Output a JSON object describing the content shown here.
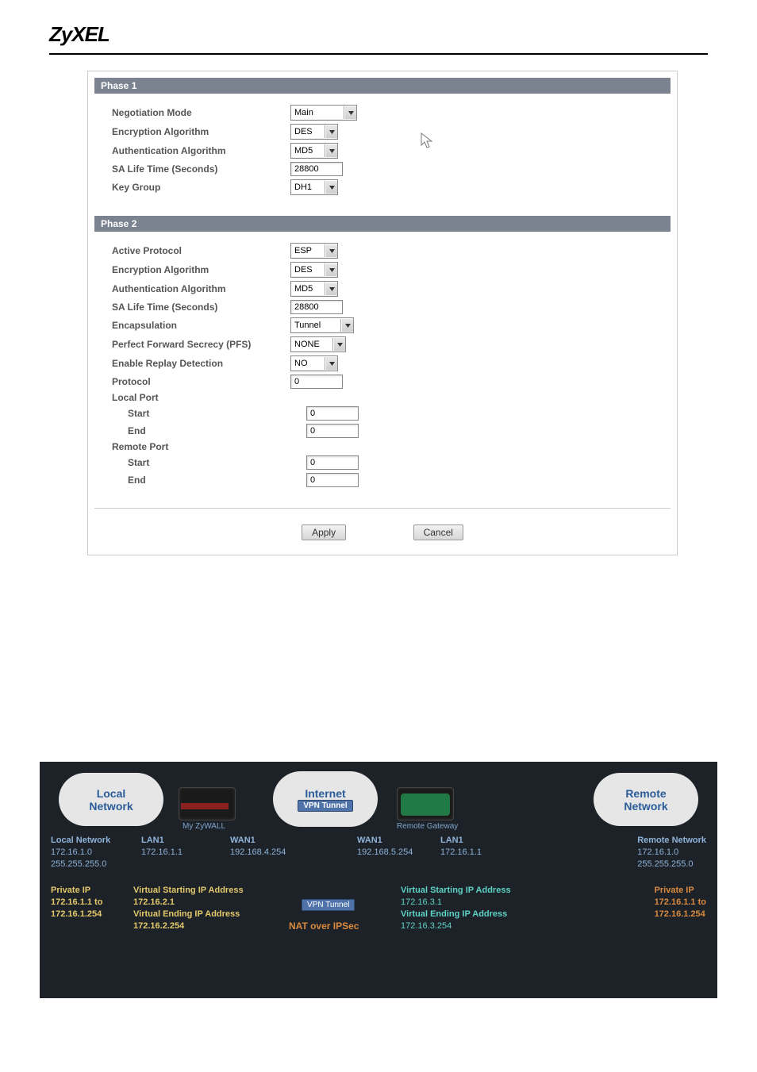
{
  "brand": "ZyXEL",
  "phase1": {
    "title": "Phase 1",
    "fields": {
      "negotiation_mode_label": "Negotiation Mode",
      "negotiation_mode_value": "Main",
      "encryption_label": "Encryption Algorithm",
      "encryption_value": "DES",
      "auth_label": "Authentication Algorithm",
      "auth_value": "MD5",
      "sa_life_label": "SA Life Time (Seconds)",
      "sa_life_value": "28800",
      "key_group_label": "Key Group",
      "key_group_value": "DH1"
    }
  },
  "phase2": {
    "title": "Phase 2",
    "fields": {
      "active_protocol_label": "Active Protocol",
      "active_protocol_value": "ESP",
      "encryption_label": "Encryption Algorithm",
      "encryption_value": "DES",
      "auth_label": "Authentication Algorithm",
      "auth_value": "MD5",
      "sa_life_label": "SA Life Time (Seconds)",
      "sa_life_value": "28800",
      "encapsulation_label": "Encapsulation",
      "encapsulation_value": "Tunnel",
      "pfs_label": "Perfect Forward Secrecy (PFS)",
      "pfs_value": "NONE",
      "replay_label": "Enable Replay Detection",
      "replay_value": "NO",
      "protocol_label": "Protocol",
      "protocol_value": "0",
      "local_port_label": "Local Port",
      "start_label": "Start",
      "local_start_value": "0",
      "end_label": "End",
      "local_end_value": "0",
      "remote_port_label": "Remote Port",
      "remote_start_value": "0",
      "remote_end_value": "0"
    }
  },
  "buttons": {
    "apply": "Apply",
    "cancel": "Cancel"
  },
  "diagram": {
    "local_cloud": "Local\nNetwork",
    "internet_cloud_l1": "Internet",
    "internet_cloud_l2": "VPN Tunnel",
    "remote_cloud": "Remote\nNetwork",
    "my_zywall": "My ZyWALL",
    "remote_gateway": "Remote Gateway",
    "local_network_label": "Local Network",
    "local_network_ip": "172.16.1.0",
    "local_network_mask": "255.255.255.0",
    "lan1_label": "LAN1",
    "lan1_ip_left": "172.16.1.1",
    "wan1_label": "WAN1",
    "wan1_ip_left": "192.168.4.254",
    "wan1_ip_right": "192.168.5.254",
    "lan1_ip_right": "172.16.1.1",
    "remote_network_label": "Remote Network",
    "remote_network_ip": "172.16.1.0",
    "remote_network_mask": "255.255.255.0",
    "private_ip_label": "Private IP",
    "private_ip_range_a": "172.16.1.1 to",
    "private_ip_range_b": "172.16.1.254",
    "vstart_label": "Virtual Starting IP Address",
    "vstart_left": "172.16.2.1",
    "vend_label": "Virtual Ending IP Address",
    "vend_left": "172.16.2.254",
    "vstart_right": "172.16.3.1",
    "vend_right": "172.16.3.254",
    "vpn_tunnel_badge": "VPN Tunnel",
    "nat_over_ipsec": "NAT over IPSec"
  }
}
